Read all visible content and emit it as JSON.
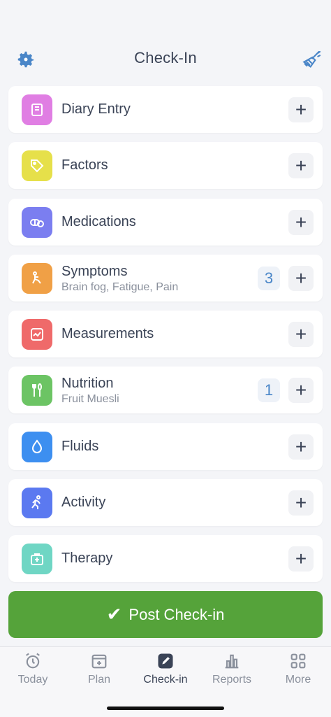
{
  "header": {
    "title": "Check-In",
    "settings_icon": "gear-icon",
    "clear_icon": "broom-icon"
  },
  "items": [
    {
      "label": "Diary Entry",
      "sub": "",
      "count": "",
      "color": "#e07ee3",
      "icon": "book-icon"
    },
    {
      "label": "Factors",
      "sub": "",
      "count": "",
      "color": "#e6e04a",
      "icon": "tag-icon"
    },
    {
      "label": "Medications",
      "sub": "",
      "count": "",
      "color": "#7b7ef0",
      "icon": "pill-icon"
    },
    {
      "label": "Symptoms",
      "sub": "Brain fog, Fatigue, Pain",
      "count": "3",
      "color": "#f0a046",
      "icon": "symptom-icon"
    },
    {
      "label": "Measurements",
      "sub": "",
      "count": "",
      "color": "#ef6a6a",
      "icon": "chart-icon"
    },
    {
      "label": "Nutrition",
      "sub": "Fruit Muesli",
      "count": "1",
      "color": "#6cc464",
      "icon": "utensils-icon"
    },
    {
      "label": "Fluids",
      "sub": "",
      "count": "",
      "color": "#3d8ff0",
      "icon": "drop-icon"
    },
    {
      "label": "Activity",
      "sub": "",
      "count": "",
      "color": "#5b79f0",
      "icon": "run-icon"
    },
    {
      "label": "Therapy",
      "sub": "",
      "count": "",
      "color": "#6fd6c4",
      "icon": "first-aid-icon"
    }
  ],
  "add_symbol": "+",
  "post_button": {
    "label": "Post Check-in",
    "check": "✔"
  },
  "tabs": [
    {
      "label": "Today",
      "icon": "alarm-clock-icon"
    },
    {
      "label": "Plan",
      "icon": "add-calendar-icon"
    },
    {
      "label": "Check-in",
      "icon": "edit-icon",
      "active": true
    },
    {
      "label": "Reports",
      "icon": "bar-chart-icon"
    },
    {
      "label": "More",
      "icon": "grid-icon"
    }
  ],
  "colors": {
    "accent_blue": "#4a86c8",
    "post_green": "#55a33a"
  }
}
